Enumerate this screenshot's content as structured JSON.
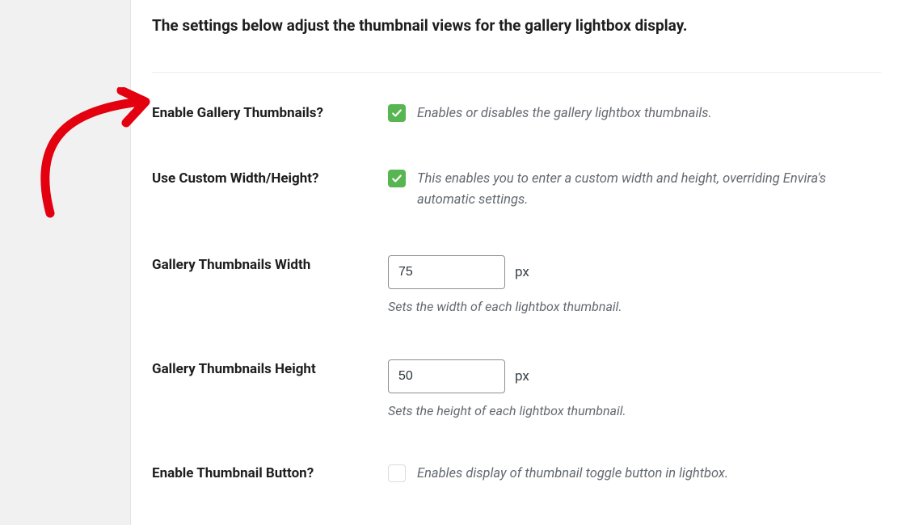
{
  "heading": "The settings below adjust the thumbnail views for the gallery lightbox display.",
  "rows": {
    "enable_thumbnails": {
      "label": "Enable Gallery Thumbnails?",
      "checked": true,
      "help": "Enables or disables the gallery lightbox thumbnails."
    },
    "custom_size": {
      "label": "Use Custom Width/Height?",
      "checked": true,
      "help": "This enables you to enter a custom width and height, overriding Envira's automatic settings."
    },
    "width": {
      "label": "Gallery Thumbnails Width",
      "value": "75",
      "unit": "px",
      "help": "Sets the width of each lightbox thumbnail."
    },
    "height": {
      "label": "Gallery Thumbnails Height",
      "value": "50",
      "unit": "px",
      "help": "Sets the height of each lightbox thumbnail."
    },
    "toggle_button": {
      "label": "Enable Thumbnail Button?",
      "checked": false,
      "help": "Enables display of thumbnail toggle button in lightbox."
    }
  }
}
